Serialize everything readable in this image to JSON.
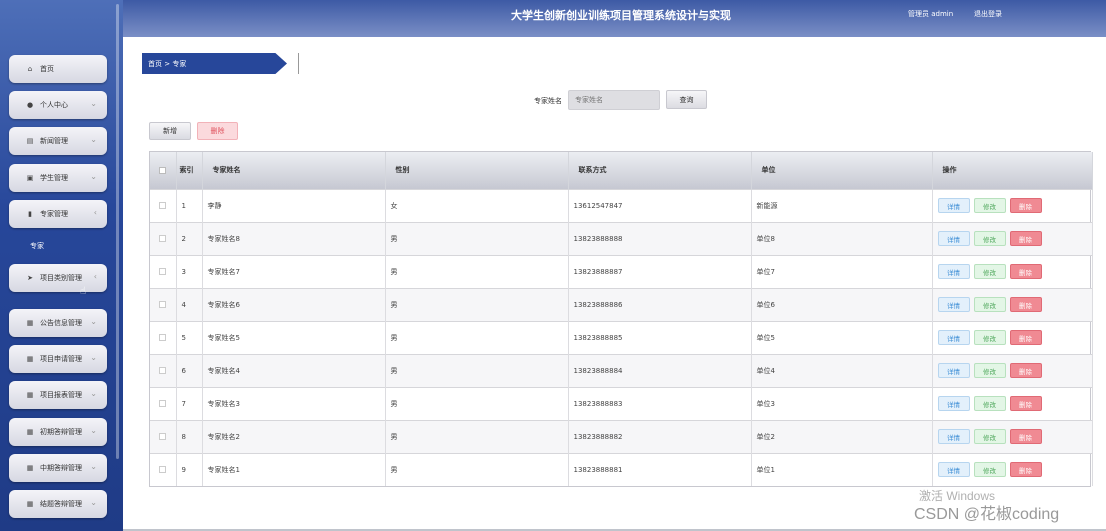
{
  "header": {
    "title": "大学生创新创业训练项目管理系统设计与实现",
    "user_label": "管理员 admin",
    "logout_label": "退出登录"
  },
  "sidebar": {
    "items": [
      {
        "label": "首页",
        "icon": "home-icon"
      },
      {
        "label": "个人中心",
        "icon": "user-icon"
      },
      {
        "label": "新闻管理",
        "icon": "news-icon"
      },
      {
        "label": "学生管理",
        "icon": "student-icon"
      },
      {
        "label": "专家管理",
        "icon": "chart-icon"
      },
      {
        "label": "项目类别管理",
        "icon": "send-icon"
      },
      {
        "label": "公告信息管理",
        "icon": "grid-icon"
      },
      {
        "label": "项目申请管理",
        "icon": "grid-icon"
      },
      {
        "label": "项目报表管理",
        "icon": "grid-icon"
      },
      {
        "label": "初期答辩管理",
        "icon": "grid-icon"
      },
      {
        "label": "中期答辩管理",
        "icon": "grid-icon"
      },
      {
        "label": "结题答辩管理",
        "icon": "grid-icon"
      }
    ],
    "sub_item": "专家"
  },
  "breadcrumb": "首页 > 专家",
  "search": {
    "label": "专家姓名",
    "placeholder": "专家姓名",
    "button": "查询"
  },
  "actions": {
    "add": "新增",
    "delete": "删除"
  },
  "table": {
    "headers": [
      "索引",
      "专家姓名",
      "性别",
      "联系方式",
      "单位",
      "操作"
    ],
    "rows": [
      {
        "index": "1",
        "name": "李静",
        "gender": "女",
        "phone": "13612547847",
        "unit": "新能源"
      },
      {
        "index": "2",
        "name": "专家姓名8",
        "gender": "男",
        "phone": "13823888888",
        "unit": "单位8"
      },
      {
        "index": "3",
        "name": "专家姓名7",
        "gender": "男",
        "phone": "13823888887",
        "unit": "单位7"
      },
      {
        "index": "4",
        "name": "专家姓名6",
        "gender": "男",
        "phone": "13823888886",
        "unit": "单位6"
      },
      {
        "index": "5",
        "name": "专家姓名5",
        "gender": "男",
        "phone": "13823888885",
        "unit": "单位5"
      },
      {
        "index": "6",
        "name": "专家姓名4",
        "gender": "男",
        "phone": "13823888884",
        "unit": "单位4"
      },
      {
        "index": "7",
        "name": "专家姓名3",
        "gender": "男",
        "phone": "13823888883",
        "unit": "单位3"
      },
      {
        "index": "8",
        "name": "专家姓名2",
        "gender": "男",
        "phone": "13823888882",
        "unit": "单位2"
      },
      {
        "index": "9",
        "name": "专家姓名1",
        "gender": "男",
        "phone": "13823888881",
        "unit": "单位1"
      }
    ],
    "op_labels": {
      "detail": "详情",
      "edit": "修改",
      "delete": "删除"
    }
  },
  "watermark": {
    "line1": "激活 Windows",
    "line2": "CSDN @花椒coding"
  },
  "colors": {
    "primary": "#27479a",
    "danger": "#f08a93",
    "success": "#4fa85c",
    "info": "#3d8ed6"
  }
}
